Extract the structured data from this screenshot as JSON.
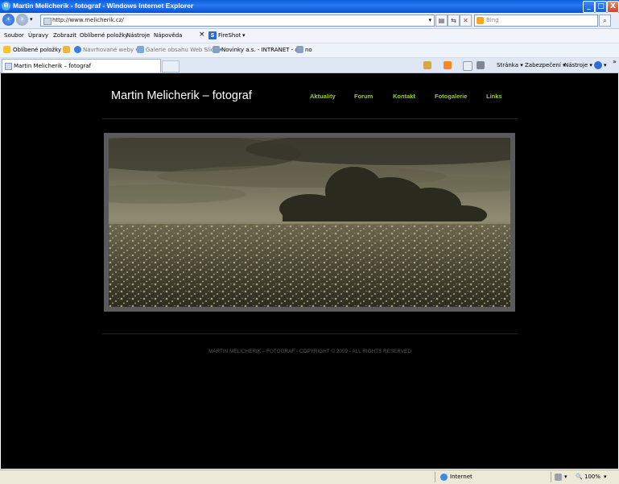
{
  "window": {
    "title": "Martin Melicherik - fotograf - Windows Internet Explorer",
    "minimize": "_",
    "maximize": "□",
    "close": "X"
  },
  "address": {
    "url": "http://www.melicherik.cz/",
    "search_placeholder": "Bing",
    "dropdown": "▾",
    "refresh": "↻",
    "go": "⇆",
    "stop": "✕",
    "search_btn": "🔍"
  },
  "menu": {
    "items": [
      "Soubor",
      "Úpravy",
      "Zobrazit",
      "Oblíbené položky",
      "Nástroje",
      "Nápověda"
    ],
    "close": "×",
    "fireshot": "FireShot",
    "fireshot_arrow": "▾"
  },
  "favorites": {
    "label": "Oblíbené položky",
    "items": [
      "Navrhované weby ▾",
      "Galerie obsahu Web Slice ▾",
      "Novinky a.s. - INTRANET - c...",
      "no"
    ]
  },
  "tab": {
    "label": "Martin Melicherik – fotograf"
  },
  "commands": {
    "page": "Stránka ▾",
    "security": "Zabezpečení ▾",
    "tools": "Nástroje ▾",
    "help": "▾",
    "more": "»"
  },
  "site": {
    "title": "Martin Melicherik – fotograf",
    "nav": [
      "Aktuality",
      "Forum",
      "Kontakt",
      "Fotogalerie",
      "Links"
    ],
    "footer": "MARTIN MELICHERIK – FOTOGRAF - COPYRIGHT © 2009 - ALL RIGHTS RESERVED"
  },
  "status": {
    "zone": "Internet",
    "zoom": "100%",
    "protected_arrow": "▾",
    "zoom_arrow": "▾"
  },
  "colors": {
    "nav_accent": "#9acd32",
    "page_bg": "#000000",
    "frame": "#5a5a5a"
  }
}
